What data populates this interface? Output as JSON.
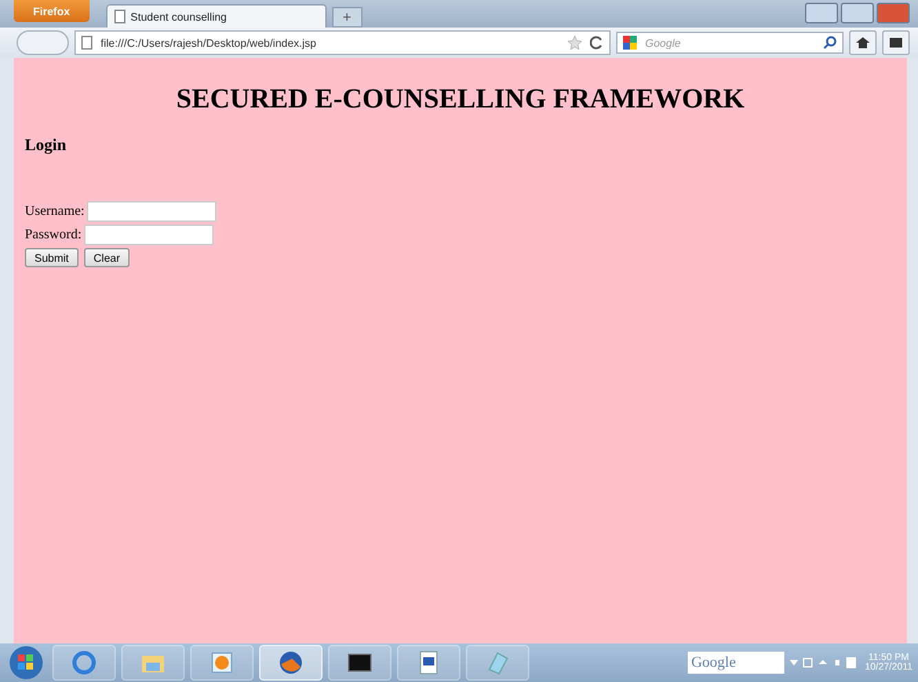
{
  "browser": {
    "menu_button": "Firefox",
    "tabs": [
      {
        "title": "Student counselling",
        "selected": true
      }
    ],
    "new_tab": "+",
    "url": "file:///C:/Users/rajesh/Desktop/web/index.jsp",
    "search": {
      "placeholder": "Google"
    }
  },
  "page": {
    "heading": "SECURED E-COUNSELLING FRAMEWORK",
    "subheading": "Login",
    "fields": [
      {
        "label": "Username:"
      },
      {
        "label": "Password:"
      }
    ],
    "buttons": [
      "Submit",
      "Clear"
    ]
  },
  "taskbar": {
    "apps": [
      {
        "kind": "ie",
        "selected": false
      },
      {
        "kind": "folder",
        "selected": false
      },
      {
        "kind": "media",
        "selected": false
      },
      {
        "kind": "firefox",
        "selected": true
      },
      {
        "kind": "terminal",
        "selected": false
      },
      {
        "kind": "word",
        "selected": false
      },
      {
        "kind": "notepad",
        "selected": false
      }
    ],
    "search_logo": "Google",
    "time": "11:50 PM",
    "date": "10/27/2011"
  }
}
